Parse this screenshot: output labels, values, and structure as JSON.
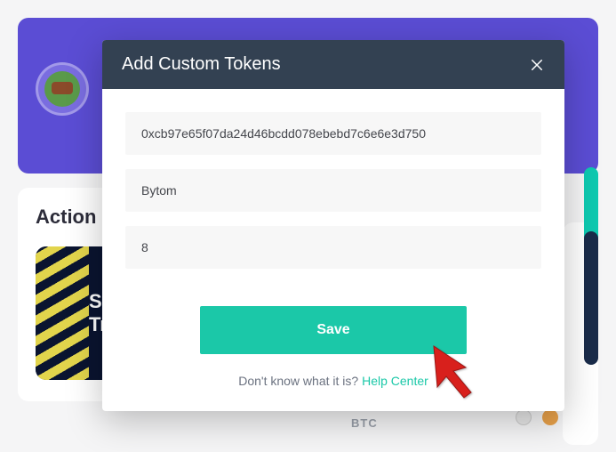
{
  "modal": {
    "title": "Add Custom Tokens",
    "address": "0xcb97e65f07da24d46bcdd078ebebd7c6e6e3d750",
    "name": "Bytom",
    "decimals": "8",
    "save_label": "Save",
    "help_prefix": "Don't know what it is? ",
    "help_link": "Help Center"
  },
  "background": {
    "action_label": "Action",
    "tile_line1": "Se",
    "tile_line2": "Tr",
    "btc_label": "BTC"
  }
}
